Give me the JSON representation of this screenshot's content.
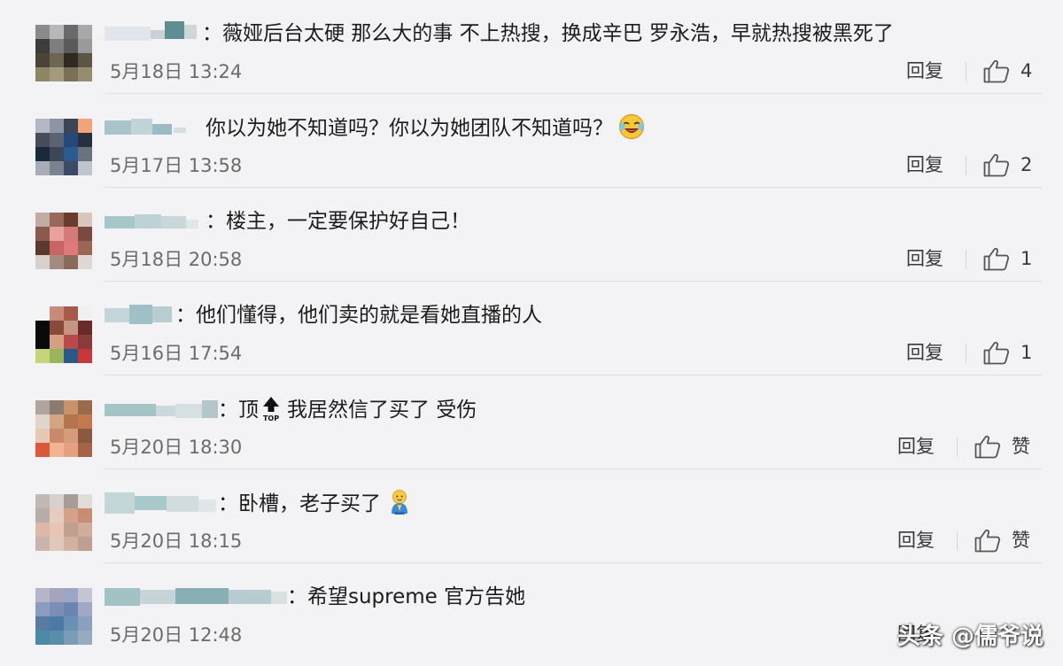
{
  "comments": [
    {
      "avatar_pixels": [
        "#8a8a8a",
        "#b8b8b8",
        "#6a6a6a",
        "#a8a8a8",
        "#3c3c3c",
        "#7e7e7e",
        "#5a5a5a",
        "#9a9a9a",
        "#4a4436",
        "#6e6650",
        "#2e2a22",
        "#5c5646",
        "#8e8466",
        "#a49a7e",
        "#7a7058",
        "#968c70"
      ],
      "text": "：薇娅后台太硬 那么大的事 不上热搜，换成辛巴 罗永浩，早就热搜被黑死了",
      "time": "5月18日 13:24",
      "reply": "回复",
      "likes": "4"
    },
    {
      "avatar_pixels": [
        "#b4b8c6",
        "#8e94a6",
        "#3d4456",
        "#f0a47a",
        "#464c5a",
        "#5c6270",
        "#27497a",
        "#283040",
        "#1a2a3c",
        "#3c4656",
        "#2b5a8e",
        "#6a7280",
        "#a8acb6",
        "#7a8290",
        "#3d4a66",
        "#c0c4cc"
      ],
      "text": "你以为她不知道吗？你以为她团队不知道吗？",
      "time": "5月17日 13:58",
      "reply": "回复",
      "likes": "2"
    },
    {
      "avatar_pixels": [
        "#c0aca4",
        "#98685a",
        "#6a3c30",
        "#d8c6be",
        "#8a5a4c",
        "#e8a0a0",
        "#d47a7a",
        "#7a4a40",
        "#5a3a30",
        "#c86464",
        "#e07a7a",
        "#9a6656",
        "#d8d0cc",
        "#a48a80",
        "#8a6a5c",
        "#e0d8d4"
      ],
      "text": "：楼主，一定要保护好自己！",
      "time": "5月18日 20:58",
      "reply": "回复",
      "likes": "1"
    },
    {
      "avatar_pixels": [
        "#f4f4f4",
        "#c88a7a",
        "#a85a4a",
        "#f0f0f0",
        "#0a0a0a",
        "#8a4a3a",
        "#c49484",
        "#6a2a2a",
        "#0a0a0a",
        "#d4a084",
        "#b84a4a",
        "#8a3a3a",
        "#c6d47a",
        "#9ab45a",
        "#2a5a8a",
        "#c43a3a"
      ],
      "text": "：他们懂得，他们卖的就是看她直播的人",
      "time": "5月16日 17:54",
      "reply": "回复",
      "likes": "1"
    },
    {
      "avatar_pixels": [
        "#b0a49c",
        "#8a7a70",
        "#c8926a",
        "#9a6a4a",
        "#e0d4cc",
        "#d4a486",
        "#b4744e",
        "#c47a50",
        "#e6c8b4",
        "#c88a6a",
        "#d49c7c",
        "#8a5a40",
        "#d85a3a",
        "#f0b494",
        "#e4a080",
        "#a4644a"
      ],
      "text_before": "：顶",
      "text_after": "我居然信了买了 受伤",
      "time": "5月20日 18:30",
      "reply": "回复",
      "likes": "赞"
    },
    {
      "avatar_pixels": [
        "#c0b8b4",
        "#d8d0cc",
        "#a89c96",
        "#e0dcda",
        "#b8aca6",
        "#e6ccc0",
        "#d4a28c",
        "#c88c74",
        "#dcb8a8",
        "#e8c4b4",
        "#c0a090",
        "#d0ac9a",
        "#c8b4ac",
        "#e0c8bc",
        "#d4b0a0",
        "#bca094"
      ],
      "text": "：卧槽，老子买了",
      "time": "5月20日 18:15",
      "reply": "回复",
      "likes": "赞"
    },
    {
      "avatar_pixels": [
        "#b6b4c8",
        "#a4a4bc",
        "#9aa6c4",
        "#c4c4d4",
        "#8c9cc0",
        "#7c8eb4",
        "#6c84b0",
        "#a0a8c4",
        "#5a7aa0",
        "#4a7aa8",
        "#6a90b4",
        "#8aa0bc",
        "#4a8aa4",
        "#5a8cac",
        "#7a9cb8",
        "#98aac0"
      ],
      "text": "：希望supreme 官方告她",
      "time": "5月20日 12:48",
      "reply": "回复"
    }
  ],
  "watermark": "头条 @儒爷说"
}
